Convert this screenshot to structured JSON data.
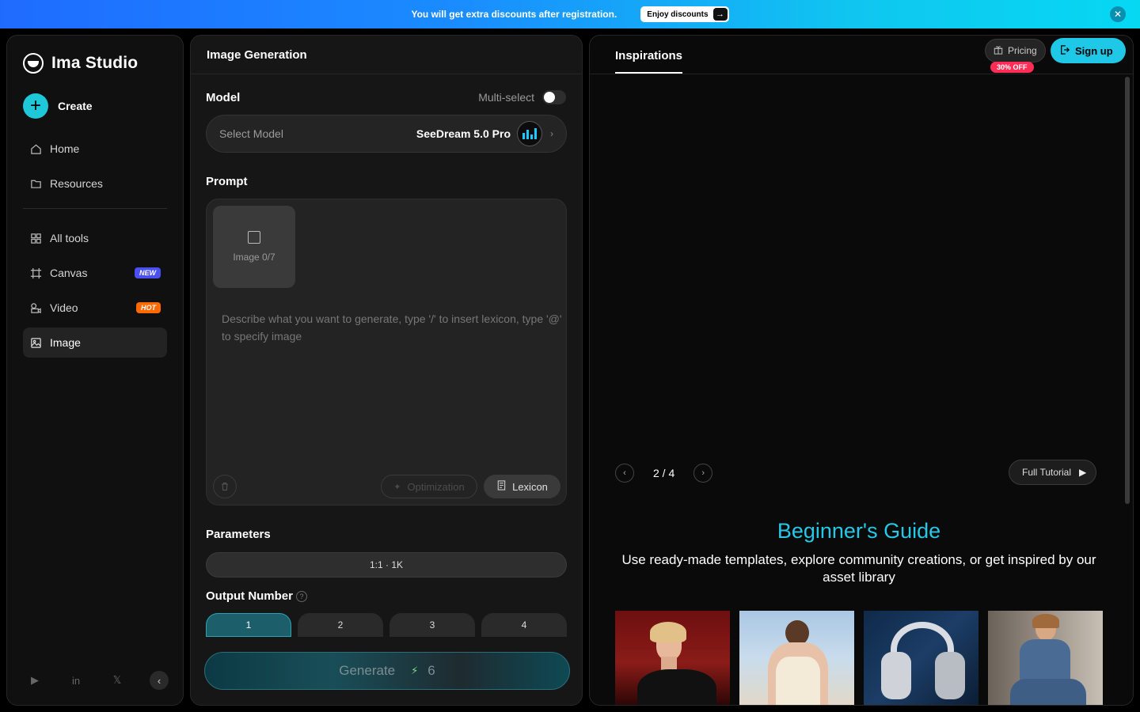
{
  "banner": {
    "message": "You will get extra discounts after registration.",
    "cta_label": "Enjoy discounts",
    "cta_arrow": "→",
    "close_glyph": "✕"
  },
  "sidebar": {
    "brand": "Ima Studio",
    "create_label": "Create",
    "create_glyph": "+",
    "primary": [
      {
        "label": "Home",
        "icon": "home-icon"
      },
      {
        "label": "Resources",
        "icon": "folder-icon"
      }
    ],
    "tools": [
      {
        "label": "All tools",
        "icon": "grid-icon",
        "badge": ""
      },
      {
        "label": "Canvas",
        "icon": "canvas-icon",
        "badge": "NEW"
      },
      {
        "label": "Video",
        "icon": "video-icon",
        "badge": "HOT"
      },
      {
        "label": "Image",
        "icon": "image-icon",
        "badge": "",
        "active": true
      }
    ],
    "footer": {
      "youtube_glyph": "▶",
      "linkedin_glyph": "in",
      "x_glyph": "𝕏",
      "collapse_glyph": "‹"
    }
  },
  "generation": {
    "title": "Image Generation",
    "model_label": "Model",
    "multi_select_label": "Multi-select",
    "multi_select_on": false,
    "model_placeholder": "Select Model",
    "model_value": "SeeDream 5.0 Pro",
    "model_chevron": "›",
    "prompt_label": "Prompt",
    "image_slot_label": "Image 0/7",
    "prompt_placeholder": "Describe what you want to generate, type '/' to insert lexicon, type '@' to specify image",
    "optimization_label": "Optimization",
    "lexicon_label": "Lexicon",
    "parameters_label": "Parameters",
    "parameters_value": "1:1 · 1K",
    "output_label": "Output Number",
    "help_glyph": "?",
    "output_options": [
      "1",
      "2",
      "3",
      "4"
    ],
    "output_selected": "1",
    "generate_label": "Generate",
    "generate_bolt": "⚡",
    "generate_cost": "6"
  },
  "inspiration": {
    "tab_label": "Inspirations",
    "pricing_label": "Pricing",
    "pricing_discount": "30% OFF",
    "signup_label": "Sign up",
    "pager_prev": "‹",
    "pager_next": "›",
    "pager_text": "2 / 4",
    "tutorial_label": "Full Tutorial",
    "tutorial_glyph": "▶",
    "guide_title": "Beginner's Guide",
    "guide_desc": "Use ready-made templates, explore community creations, or get inspired by our asset library"
  },
  "colors": {
    "accent": "#1ec8e6",
    "new_badge": "#4a4ff0",
    "hot_badge": "#ff6a00",
    "discount": "#ff2d55"
  }
}
